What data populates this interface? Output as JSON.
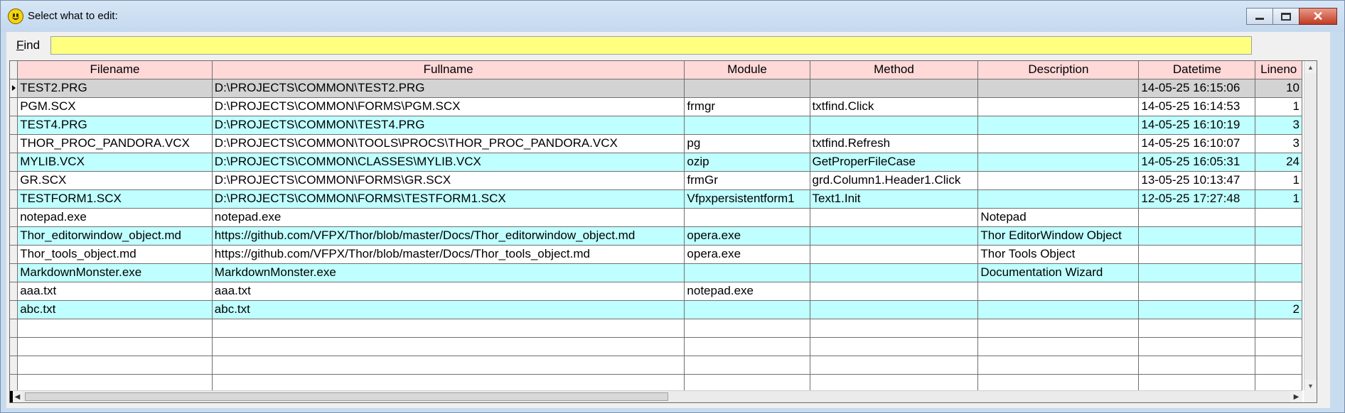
{
  "window": {
    "title": "Select what to edit:",
    "minimize_icon": "minimize-icon",
    "maximize_icon": "maximize-icon",
    "close_glyph": "✕"
  },
  "find": {
    "label_accel": "F",
    "label_rest": "ind",
    "value": "",
    "placeholder": ""
  },
  "colors": {
    "header_bg": "#ffd8d8",
    "row_alt": "#c0ffff",
    "selected_row": "#d3d3d3",
    "find_bg": "#ffff80"
  },
  "grid": {
    "columns": [
      "Filename",
      "Fullname",
      "Module",
      "Method",
      "Description",
      "Datetime",
      "Lineno"
    ],
    "rows": [
      {
        "Filename": "TEST2.PRG",
        "Fullname": "D:\\PROJECTS\\COMMON\\TEST2.PRG",
        "Module": "",
        "Method": "",
        "Description": "",
        "Datetime": "14-05-25 16:15:06",
        "Lineno": "10"
      },
      {
        "Filename": "PGM.SCX",
        "Fullname": "D:\\PROJECTS\\COMMON\\FORMS\\PGM.SCX",
        "Module": "frmgr",
        "Method": "txtfind.Click",
        "Description": "",
        "Datetime": "14-05-25 16:14:53",
        "Lineno": "1"
      },
      {
        "Filename": "TEST4.PRG",
        "Fullname": "D:\\PROJECTS\\COMMON\\TEST4.PRG",
        "Module": "",
        "Method": "",
        "Description": "",
        "Datetime": "14-05-25 16:10:19",
        "Lineno": "3"
      },
      {
        "Filename": "THOR_PROC_PANDORA.VCX",
        "Fullname": "D:\\PROJECTS\\COMMON\\TOOLS\\PROCS\\THOR_PROC_PANDORA.VCX",
        "Module": "pg",
        "Method": "txtfind.Refresh",
        "Description": "",
        "Datetime": "14-05-25 16:10:07",
        "Lineno": "3"
      },
      {
        "Filename": "MYLIB.VCX",
        "Fullname": "D:\\PROJECTS\\COMMON\\CLASSES\\MYLIB.VCX",
        "Module": "ozip",
        "Method": "GetProperFileCase",
        "Description": "",
        "Datetime": "14-05-25 16:05:31",
        "Lineno": "24"
      },
      {
        "Filename": "GR.SCX",
        "Fullname": "D:\\PROJECTS\\COMMON\\FORMS\\GR.SCX",
        "Module": "frmGr",
        "Method": "grd.Column1.Header1.Click",
        "Description": "",
        "Datetime": "13-05-25 10:13:47",
        "Lineno": "1"
      },
      {
        "Filename": "TESTFORM1.SCX",
        "Fullname": "D:\\PROJECTS\\COMMON\\FORMS\\TESTFORM1.SCX",
        "Module": "Vfpxpersistentform1",
        "Method": "Text1.Init",
        "Description": "",
        "Datetime": "12-05-25 17:27:48",
        "Lineno": "1"
      },
      {
        "Filename": "notepad.exe",
        "Fullname": "notepad.exe",
        "Module": "",
        "Method": "",
        "Description": "Notepad",
        "Datetime": "",
        "Lineno": ""
      },
      {
        "Filename": "Thor_editorwindow_object.md",
        "Fullname": "https://github.com/VFPX/Thor/blob/master/Docs/Thor_editorwindow_object.md",
        "Module": "opera.exe",
        "Method": "",
        "Description": "Thor EditorWindow Object",
        "Datetime": "",
        "Lineno": ""
      },
      {
        "Filename": "Thor_tools_object.md",
        "Fullname": "https://github.com/VFPX/Thor/blob/master/Docs/Thor_tools_object.md",
        "Module": "opera.exe",
        "Method": "",
        "Description": "Thor Tools Object",
        "Datetime": "",
        "Lineno": ""
      },
      {
        "Filename": "MarkdownMonster.exe",
        "Fullname": "MarkdownMonster.exe",
        "Module": "",
        "Method": "",
        "Description": "Documentation Wizard",
        "Datetime": "",
        "Lineno": ""
      },
      {
        "Filename": "aaa.txt",
        "Fullname": "aaa.txt",
        "Module": "notepad.exe",
        "Method": "",
        "Description": "",
        "Datetime": "",
        "Lineno": ""
      },
      {
        "Filename": "abc.txt",
        "Fullname": "abc.txt",
        "Module": "",
        "Method": "",
        "Description": "",
        "Datetime": "",
        "Lineno": "2"
      }
    ],
    "selected_row_index": 0,
    "empty_rows": 4
  },
  "scrollbars": {
    "left_arrow": "◀",
    "right_arrow": "▶",
    "up_arrow": "▲",
    "down_arrow": "▼"
  }
}
